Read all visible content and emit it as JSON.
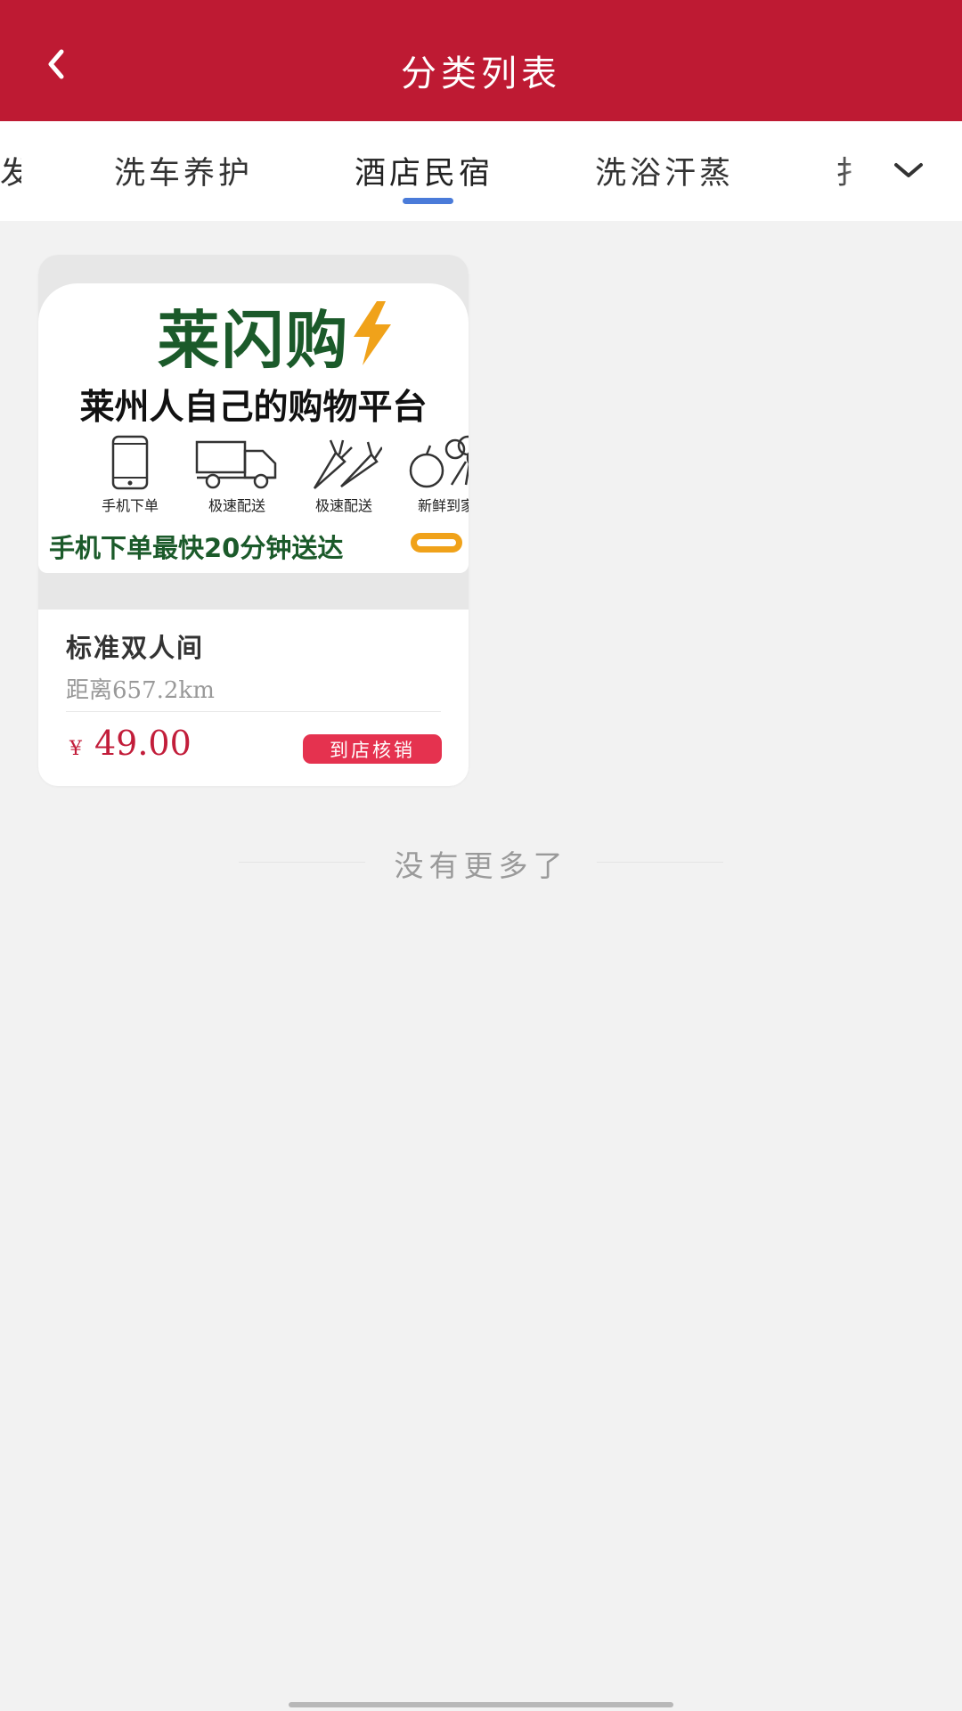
{
  "header": {
    "title": "分类列表",
    "back_icon": "chevron-left-icon",
    "bg_color": "#be1a33"
  },
  "tabs": {
    "items": [
      "发",
      "洗车养护",
      "酒店民宿",
      "洗浴汗蒸",
      "扌"
    ],
    "active_index": 2,
    "active_underline_color": "#4a7bd9",
    "more_icon": "chevron-down-icon"
  },
  "product": {
    "banner": {
      "title": "莱闪购",
      "subtitle": "莱州人自己的购物平台",
      "features": [
        "手机下单",
        "极速配送",
        "极速配送",
        "新鲜到家"
      ],
      "slogan": "手机下单最快20分钟送达"
    },
    "name": "标准双人间",
    "distance": "距离657.2km",
    "price_symbol": "¥",
    "price": "49.00",
    "action_label": "到店核销",
    "accent_color": "#c21d3a"
  },
  "footer": {
    "no_more_text": "没有更多了"
  }
}
